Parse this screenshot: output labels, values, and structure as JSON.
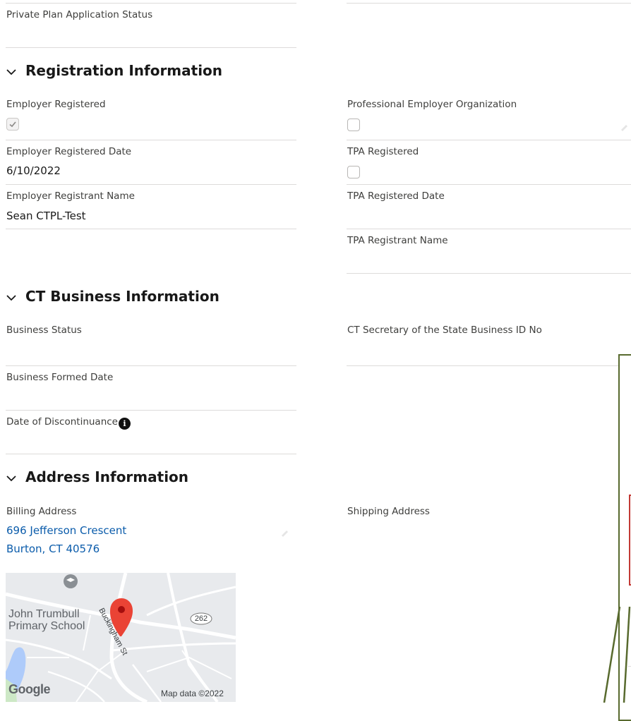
{
  "top": {
    "private_plan_label": "Private Plan Application Status"
  },
  "registration": {
    "title": "Registration Information",
    "employer_registered_label": "Employer Registered",
    "employer_registered_checked": true,
    "professional_employer_org_label": "Professional Employer Organization",
    "professional_employer_org_checked": false,
    "employer_registered_date_label": "Employer Registered Date",
    "employer_registered_date_value": "6/10/2022",
    "tpa_registered_label": "TPA Registered",
    "tpa_registered_checked": false,
    "employer_registrant_name_label": "Employer Registrant Name",
    "employer_registrant_name_value": "Sean CTPL-Test",
    "tpa_registered_date_label": "TPA Registered Date",
    "tpa_registrant_name_label": "TPA Registrant Name"
  },
  "ct_business": {
    "title": "CT Business Information",
    "business_status_label": "Business Status",
    "sots_business_id_label": "CT Secretary of the State Business ID No",
    "business_formed_date_label": "Business Formed Date",
    "date_of_discontinuance_label": "Date of Discontinuance"
  },
  "address": {
    "title": "Address Information",
    "billing_label": "Billing Address",
    "billing_line1": "696 Jefferson Crescent",
    "billing_line2": "Burton, CT 40576",
    "shipping_label": "Shipping Address"
  },
  "map": {
    "school_line1": "John Trumbull",
    "school_line2": "Primary School",
    "street_label": "Buckingham St",
    "route_label": "262",
    "logo": "Google",
    "attribution": "Map data ©2022"
  },
  "colors": {
    "link": "#0b5cab",
    "rule": "#dddbda",
    "map_pin": "#ea4335",
    "dialog_outline": "#586a2e"
  }
}
